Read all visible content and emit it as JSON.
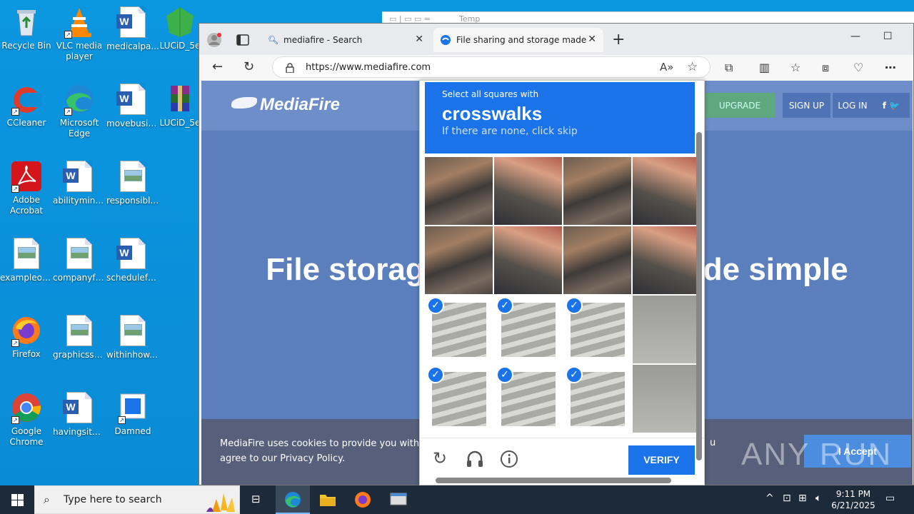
{
  "desktop": {
    "icons": [
      {
        "label": "Recycle Bin",
        "icon": "recycle-bin-icon"
      },
      {
        "label": "VLC media player",
        "icon": "vlc-icon"
      },
      {
        "label": "medicalpa...",
        "icon": "word-doc-icon"
      },
      {
        "label": "LUCiD_5e",
        "icon": "green-gem-icon"
      },
      {
        "label": "CCleaner",
        "icon": "ccleaner-icon"
      },
      {
        "label": "Microsoft Edge",
        "icon": "edge-icon"
      },
      {
        "label": "movebusin...",
        "icon": "word-doc-icon"
      },
      {
        "label": "LUCiD_5e",
        "icon": "winrar-icon"
      },
      {
        "label": "Adobe Acrobat",
        "icon": "acrobat-icon"
      },
      {
        "label": "abilityminu...",
        "icon": "word-doc-icon"
      },
      {
        "label": "responsible...",
        "icon": "image-file-icon"
      },
      {
        "label": "exampleonl...",
        "icon": "image-file-icon"
      },
      {
        "label": "companyfa...",
        "icon": "image-file-icon"
      },
      {
        "label": "schedulefa...",
        "icon": "word-doc-icon"
      },
      {
        "label": "Firefox",
        "icon": "firefox-icon"
      },
      {
        "label": "graphicssel...",
        "icon": "image-file-icon"
      },
      {
        "label": "withinhow....",
        "icon": "image-file-icon"
      },
      {
        "label": "Google Chrome",
        "icon": "chrome-icon"
      },
      {
        "label": "havingsite.rtf",
        "icon": "word-doc-icon"
      },
      {
        "label": "Damned",
        "icon": "blue-file-icon"
      }
    ]
  },
  "explorer_behind": {
    "title": "Temp"
  },
  "browser": {
    "tabs": [
      {
        "label": "mediafire - Search",
        "icon": "search-icon"
      },
      {
        "label": "File sharing and storage made sir",
        "icon": "mediafire-icon"
      }
    ],
    "url": "https://www.mediafire.com",
    "window_controls": [
      "—",
      "☐"
    ]
  },
  "page": {
    "logo": "MediaFire",
    "nav": {
      "upgrade": "UPGRADE",
      "signup": "SIGN UP",
      "login": "LOG IN",
      "social": "f  🐦"
    },
    "hero_left": "File storag",
    "hero_right": "de simple",
    "cookie_text": "MediaFire uses cookies to provide you with a p",
    "cookie_text_2": "agree to our Privacy Policy.",
    "cookie_tail": "u",
    "accept": "I Accept"
  },
  "captcha": {
    "prompt_small": "Select all squares with",
    "prompt_big": "crosswalks",
    "prompt_sub": "If there are none, click skip",
    "verify": "VERIFY",
    "grid_rows": [
      [
        false,
        false,
        false,
        false
      ],
      [
        false,
        false,
        false,
        false
      ],
      [
        true,
        true,
        true,
        false
      ],
      [
        true,
        true,
        true,
        false
      ]
    ]
  },
  "watermark": "ANY RUN",
  "taskbar": {
    "search_placeholder": "Type here to search",
    "time": "9:11 PM",
    "date": "6/21/2025"
  },
  "colors": {
    "captcha_blue": "#1a73e8",
    "desktop_blue": "#0a8fd6",
    "taskbar": "#1c2a3a"
  }
}
